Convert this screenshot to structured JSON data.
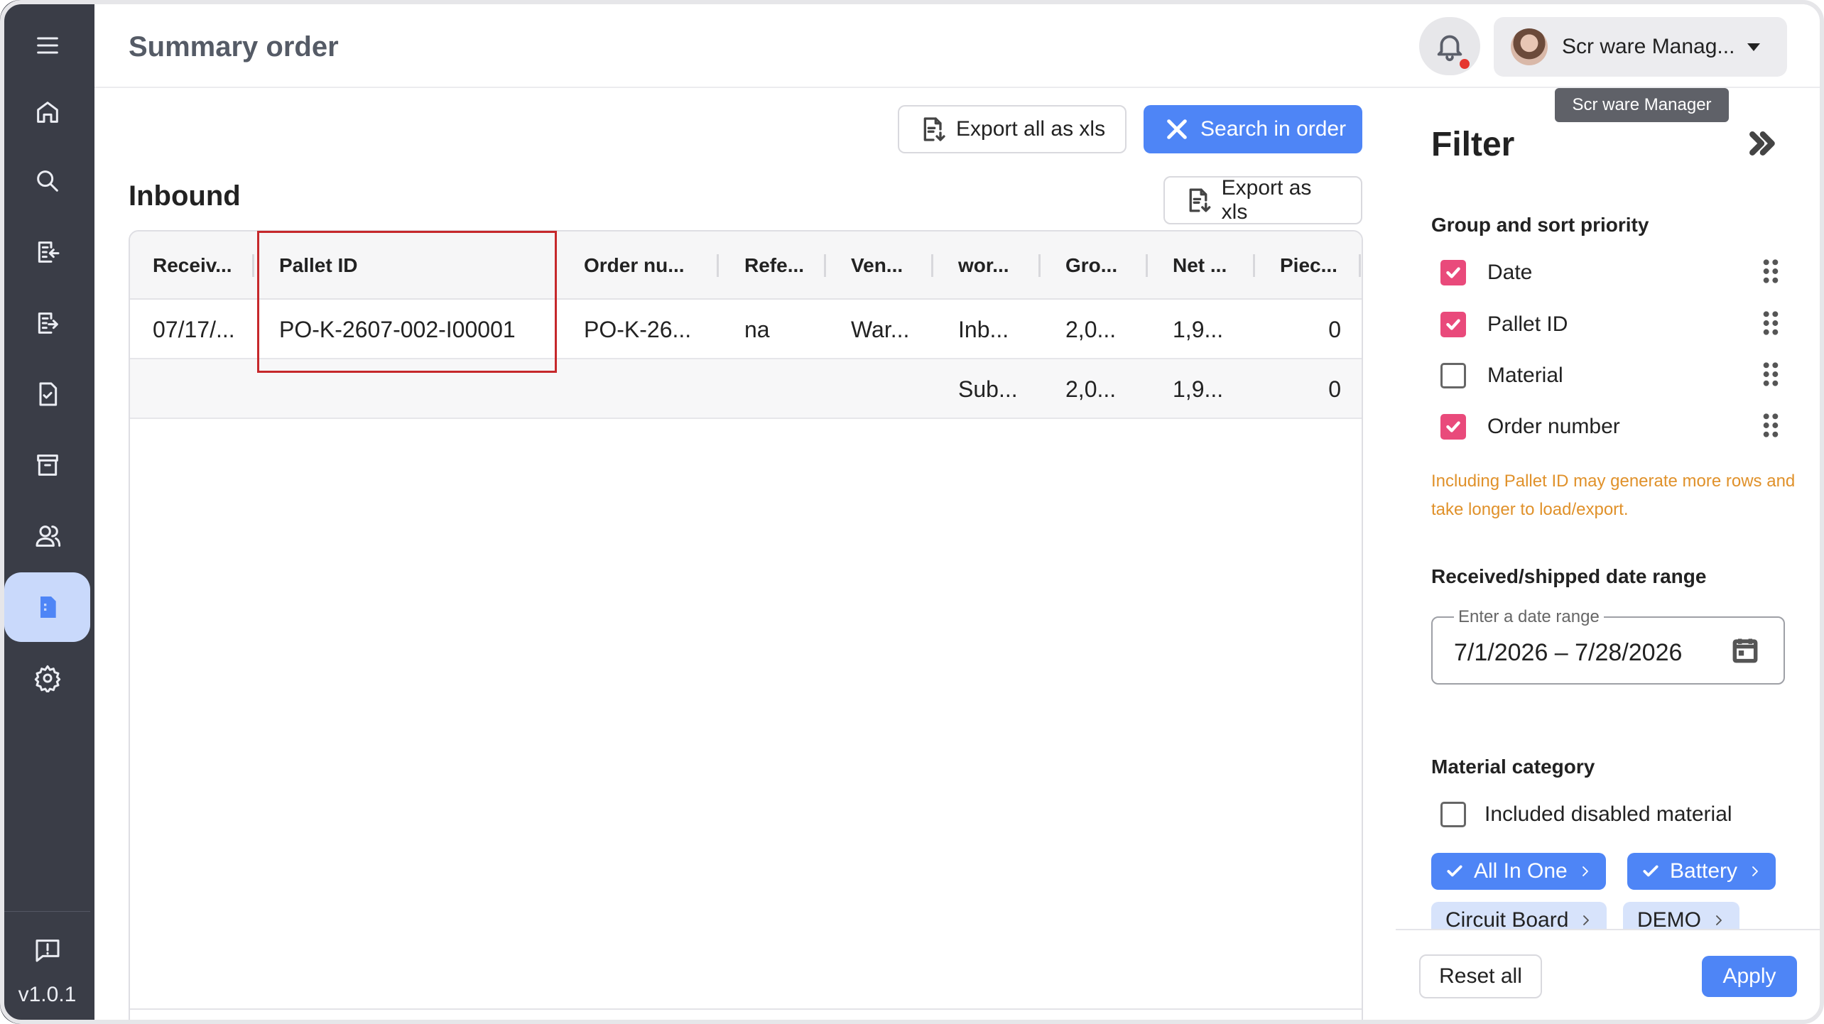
{
  "app": {
    "version": "v1.0.1"
  },
  "topbar": {
    "title": "Summary order",
    "user_name": "Scr ware Manag...",
    "tooltip": "Scr ware Manager"
  },
  "actions": {
    "export_all": "Export all as xls",
    "search_in_order": "Search in order"
  },
  "inbound": {
    "title": "Inbound",
    "export": "Export as xls",
    "columns": [
      "Receiv...",
      "Pallet ID",
      "Order nu...",
      "Refe...",
      "Ven...",
      "wor...",
      "Gro...",
      "Net ...",
      "Piec..."
    ],
    "rows": [
      [
        "07/17/...",
        "PO-K-2607-002-I00001",
        "PO-K-26...",
        "na",
        "War...",
        "Inb...",
        "2,0...",
        "1,9...",
        "0"
      ]
    ],
    "subtotal": {
      "label": "Sub...",
      "gross": "2,0...",
      "net": "1,9...",
      "pieces": "0"
    }
  },
  "filter": {
    "title": "Filter",
    "group_sort_heading": "Group and sort priority",
    "sort_items": [
      {
        "label": "Date",
        "checked": true
      },
      {
        "label": "Pallet ID",
        "checked": true
      },
      {
        "label": "Material",
        "checked": false
      },
      {
        "label": "Order number",
        "checked": true
      }
    ],
    "warning": "Including Pallet ID may generate more rows and take longer to load/export.",
    "date_heading": "Received/shipped date range",
    "date_label": "Enter a date range",
    "date_value": "7/1/2026 – 7/28/2026",
    "material_heading": "Material category",
    "include_disabled": "Included disabled material",
    "include_disabled_checked": false,
    "chips": [
      {
        "label": "All In One",
        "selected": true
      },
      {
        "label": "Battery",
        "selected": true
      },
      {
        "label": "Circuit Board",
        "selected": false
      },
      {
        "label": "DEMO",
        "selected": false
      }
    ],
    "reset": "Reset all",
    "apply": "Apply"
  },
  "colors": {
    "primary": "#4e85f6",
    "checkbox": "#e94a7b",
    "sidebar": "#3a3d47",
    "warning": "#e0912a",
    "highlight": "#c6282b",
    "notification": "#e5362f"
  },
  "icons": {
    "sidebar": [
      "menu-icon",
      "home-icon",
      "search-icon",
      "inbound-icon",
      "outbound-icon",
      "checklist-icon",
      "archive-icon",
      "users-icon",
      "report-icon",
      "settings-icon",
      "feedback-icon"
    ]
  }
}
